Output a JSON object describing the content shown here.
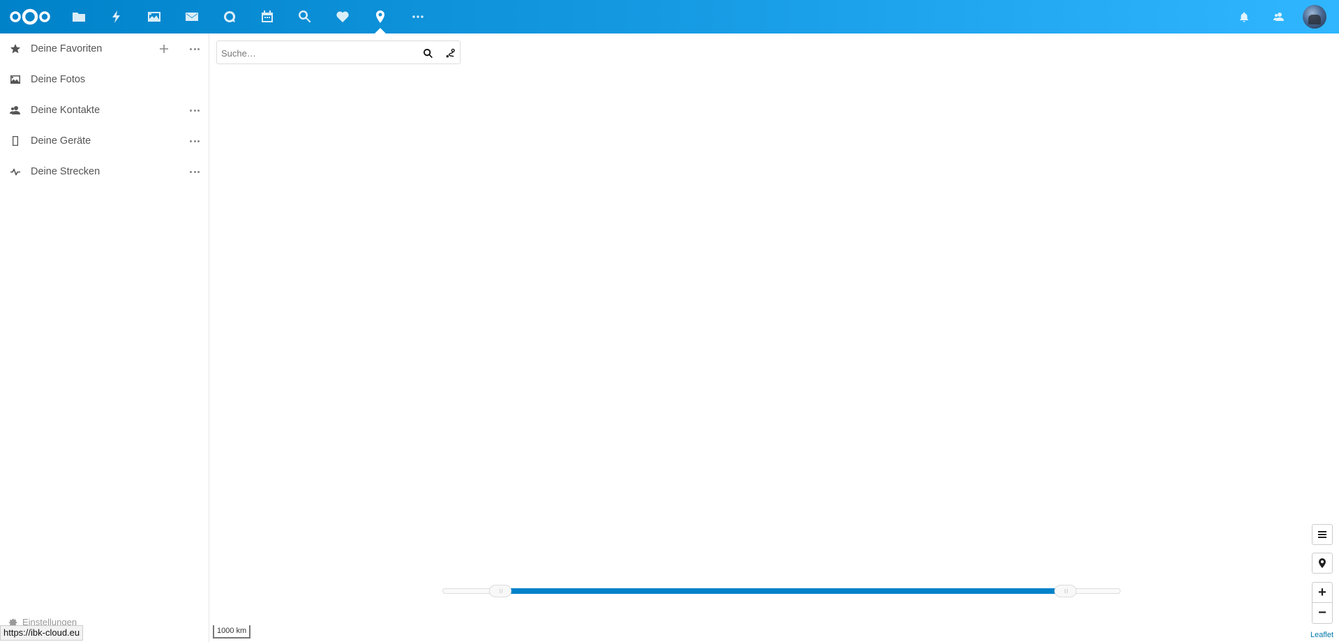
{
  "header": {
    "apps": [
      {
        "name": "files",
        "icon": "folder-icon"
      },
      {
        "name": "activity",
        "icon": "lightning-icon"
      },
      {
        "name": "photos",
        "icon": "image-icon"
      },
      {
        "name": "mail",
        "icon": "mail-icon"
      },
      {
        "name": "talk",
        "icon": "chat-icon"
      },
      {
        "name": "calendar",
        "icon": "calendar-icon"
      },
      {
        "name": "search",
        "icon": "magnify-icon"
      },
      {
        "name": "favorites",
        "icon": "heart-icon"
      },
      {
        "name": "maps",
        "icon": "map-marker-icon",
        "active": true
      },
      {
        "name": "more",
        "icon": "more-icon"
      }
    ],
    "right": [
      "bell-icon",
      "contacts-icon",
      "avatar"
    ],
    "accent_color": "#0082c9"
  },
  "sidebar": {
    "items": [
      {
        "label": "Deine Favoriten",
        "icon": "star-icon"
      },
      {
        "label": "Deine Fotos",
        "icon": "image-icon"
      },
      {
        "label": "Deine Kontakte",
        "icon": "contacts-icon"
      },
      {
        "label": "Deine Geräte",
        "icon": "phone-icon"
      },
      {
        "label": "Deine Strecken",
        "icon": "track-icon"
      }
    ],
    "settings_label": "Einstellungen"
  },
  "search": {
    "placeholder": "Suche…",
    "value": ""
  },
  "time_slider": {
    "range_start_fraction": 0.085,
    "range_end_fraction": 0.92
  },
  "map": {
    "scale_label": "1000 km",
    "attribution": "Leaflet"
  },
  "status_url": "https://ibk-cloud.eu"
}
